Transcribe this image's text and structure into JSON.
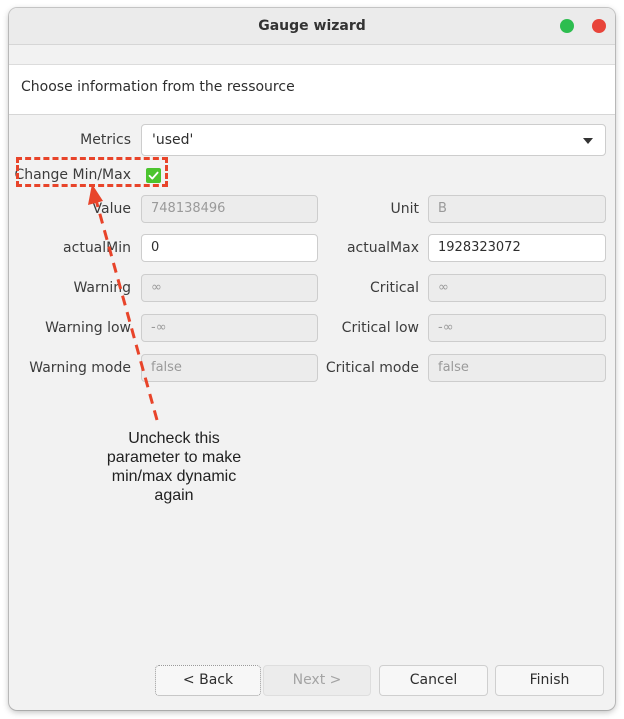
{
  "window": {
    "title": "Gauge wizard"
  },
  "header": {
    "text": "Choose information from the ressource"
  },
  "metrics": {
    "label": "Metrics",
    "value": "'used'"
  },
  "change_minmax": {
    "label": "Change Min/Max",
    "checked": true
  },
  "fields": {
    "value": {
      "label": "Value",
      "value": "748138496"
    },
    "unit": {
      "label": "Unit",
      "value": "B"
    },
    "actual_min": {
      "label": "actualMin",
      "value": "0"
    },
    "actual_max": {
      "label": "actualMax",
      "value": "1928323072"
    },
    "warning": {
      "label": "Warning",
      "value": "∞"
    },
    "critical": {
      "label": "Critical",
      "value": "∞"
    },
    "warning_low": {
      "label": "Warning low",
      "value": "-∞"
    },
    "critical_low": {
      "label": "Critical low",
      "value": "-∞"
    },
    "warning_mode": {
      "label": "Warning mode",
      "value": "false"
    },
    "critical_mode": {
      "label": "Critical mode",
      "value": "false"
    }
  },
  "annotation": {
    "text": "Uncheck this\nparameter to make\nmin/max dynamic\nagain"
  },
  "buttons": {
    "back": "< Back",
    "next": "Next >",
    "cancel": "Cancel",
    "finish": "Finish"
  },
  "colors": {
    "window_max": "#2dbd4f",
    "window_close": "#e8443a",
    "checkbox": "#4bc42e",
    "annotation_accent": "#e8442a"
  }
}
